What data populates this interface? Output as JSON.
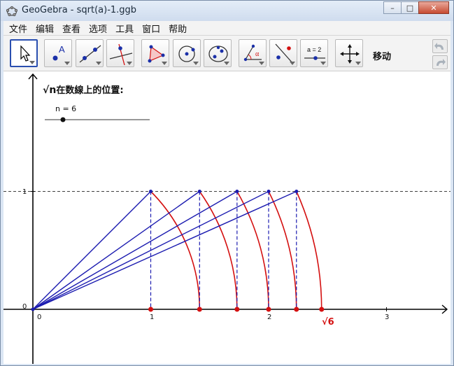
{
  "window": {
    "title": "GeoGebra - sqrt(a)-1.ggb",
    "minimize": "–",
    "maximize": "□",
    "close": "✕"
  },
  "menu": [
    "文件",
    "编辑",
    "查看",
    "选项",
    "工具",
    "窗口",
    "帮助"
  ],
  "toolbar": {
    "tools": [
      {
        "name": "move-tool",
        "icon": "arrow-cursor-icon"
      },
      {
        "name": "point-tool",
        "icon": "point-A-icon"
      },
      {
        "name": "line-tool",
        "icon": "line-through-points-icon"
      },
      {
        "name": "perpendicular-tool",
        "icon": "perpendicular-line-icon"
      },
      {
        "name": "polygon-tool",
        "icon": "polygon-icon"
      },
      {
        "name": "circle-tool",
        "icon": "circle-center-point-icon"
      },
      {
        "name": "conic-tool",
        "icon": "ellipse-icon"
      },
      {
        "name": "angle-tool",
        "icon": "angle-alpha-icon"
      },
      {
        "name": "reflect-tool",
        "icon": "reflect-about-line-icon"
      },
      {
        "name": "slider-tool",
        "icon": "slider-a=2-icon"
      },
      {
        "name": "move-graphics-tool",
        "icon": "move-cross-arrows-icon"
      }
    ],
    "slider_icon_text": "a = 2",
    "current_tool_label": "移动"
  },
  "graphics": {
    "heading_radical": "√n",
    "heading_text": "在数線上的位置:",
    "slider_label": "n = 6",
    "slider_value": 6,
    "y_ticks": [
      "1",
      "0"
    ],
    "x_ticks": [
      "0",
      "1",
      "2",
      "3"
    ],
    "result_label": "√6",
    "colors": {
      "segments": "#1b1bb0",
      "arcs": "#d41010",
      "points": "#d41010",
      "axes": "#000000"
    }
  }
}
